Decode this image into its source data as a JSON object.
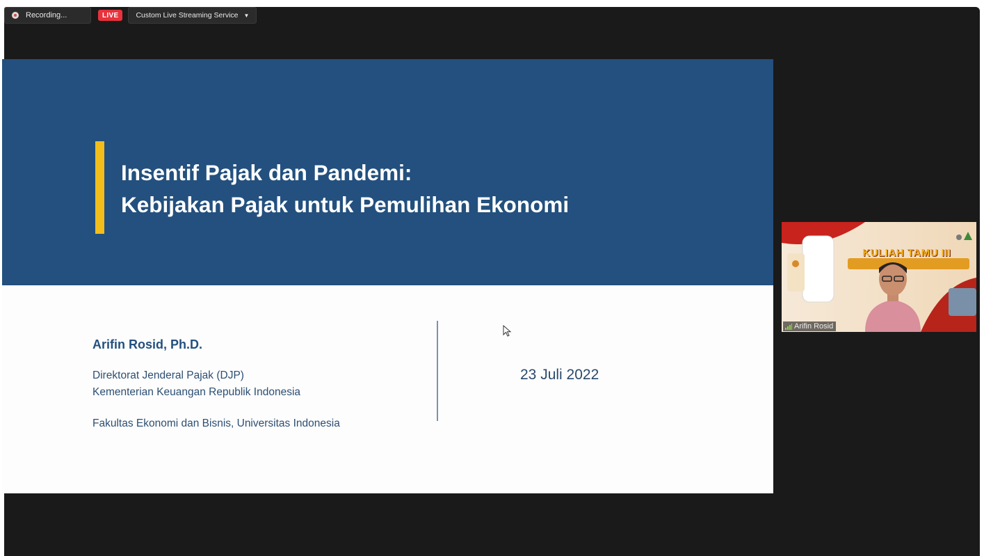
{
  "topbar": {
    "recording_label": "Recording...",
    "live_label": "LIVE",
    "stream_service_label": "Custom Live Streaming Service"
  },
  "slide": {
    "title_line1": "Insentif Pajak dan Pandemi:",
    "title_line2": "Kebijakan Pajak untuk Pemulihan Ekonomi",
    "author": "Arifin Rosid, Ph.D.",
    "affiliation_line1": "Direktorat Jenderal Pajak (DJP)",
    "affiliation_line2": "Kementerian Keuangan Republik Indonesia",
    "affiliation_line3": "Fakultas Ekonomi dan Bisnis, Universitas Indonesia",
    "date": "23 Juli 2022"
  },
  "participant": {
    "name": "Arifin Rosid",
    "background_banner": "KULIAH TAMU III"
  },
  "colors": {
    "slide_header": "#23507e",
    "accent_bar": "#f3be1b",
    "live_badge": "#e8323c",
    "app_background": "#1a1a1a"
  }
}
